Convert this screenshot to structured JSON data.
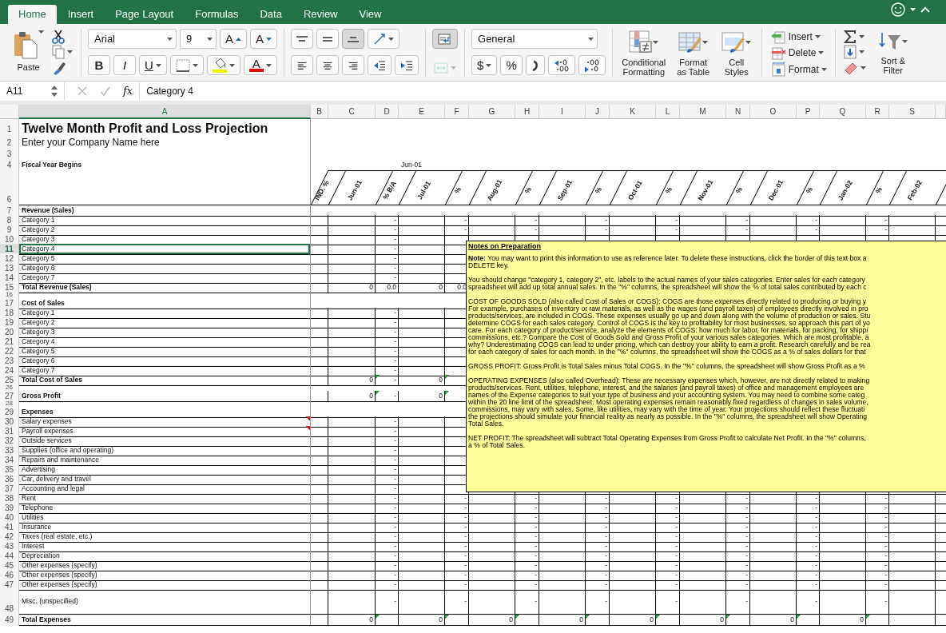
{
  "ribbon_tabs": [
    {
      "label": "Home",
      "selected": true
    },
    {
      "label": "Insert",
      "selected": false
    },
    {
      "label": "Page Layout",
      "selected": false
    },
    {
      "label": "Formulas",
      "selected": false
    },
    {
      "label": "Data",
      "selected": false
    },
    {
      "label": "Review",
      "selected": false
    },
    {
      "label": "View",
      "selected": false
    }
  ],
  "ribbon": {
    "clipboard": {
      "paste_label": "Paste"
    },
    "font": {
      "name": "Arial",
      "size": "9",
      "grow_glyph": "A",
      "shrink_glyph": "A",
      "bold_glyph": "B",
      "italic_glyph": "I",
      "underline_glyph": "U",
      "font_color_glyph": "A"
    },
    "alignment": {
      "vertical": [
        {
          "pressed": false
        },
        {
          "pressed": false
        },
        {
          "pressed": true
        }
      ],
      "wrap_text": {
        "pressed": true
      },
      "merge": {
        "disabled": true
      }
    },
    "number": {
      "format": "General",
      "currency_glyph": "$",
      "percent_glyph": "%"
    },
    "styles": [
      {
        "kind": "conditional",
        "label": "Conditional Formatting"
      },
      {
        "kind": "table",
        "label": "Format as Table"
      },
      {
        "kind": "cell_styles",
        "label": "Cell Styles"
      }
    ],
    "cells": [
      {
        "kind": "insert",
        "label": "Insert"
      },
      {
        "kind": "delete",
        "label": "Delete"
      },
      {
        "kind": "format",
        "label": "Format"
      }
    ],
    "editing": {
      "sort_label": "Sort & Filter"
    }
  },
  "formula_bar": {
    "name_box": "A11",
    "fx": "fx",
    "value": "Category 4"
  },
  "columns": [
    {
      "label": "A",
      "selected": true
    },
    {
      "label": "B",
      "selected": false
    },
    {
      "label": "C",
      "selected": false
    },
    {
      "label": "D",
      "selected": false
    },
    {
      "label": "E",
      "selected": false
    },
    {
      "label": "F",
      "selected": false
    },
    {
      "label": "G",
      "selected": false
    },
    {
      "label": "H",
      "selected": false
    },
    {
      "label": "I",
      "selected": false
    },
    {
      "label": "J",
      "selected": false
    },
    {
      "label": "K",
      "selected": false
    },
    {
      "label": "L",
      "selected": false
    },
    {
      "label": "M",
      "selected": false
    },
    {
      "label": "N",
      "selected": false
    },
    {
      "label": "O",
      "selected": false
    },
    {
      "label": "P",
      "selected": false
    },
    {
      "label": "Q",
      "selected": false
    },
    {
      "label": "R",
      "selected": false
    },
    {
      "label": "S",
      "selected": false
    }
  ],
  "rows": [
    {
      "number": "1",
      "kind": "title",
      "label": "Twelve Month Profit and Loss Projection",
      "selected": false
    },
    {
      "number": "2",
      "kind": "subtitle",
      "label": "Enter your Company Name here",
      "selected": false
    },
    {
      "number": "3",
      "kind": "blank",
      "selected": false
    },
    {
      "number": "4",
      "kind": "fiscal",
      "label": "Fiscal Year Begins",
      "cells": {
        "E": "Jun-01"
      },
      "selected": false
    },
    {
      "number": "6",
      "kind": "headers",
      "cells": {
        "B": "IND. %",
        "C": "Jun-01",
        "D": "% B/A",
        "E": "Jul-01",
        "F": "%",
        "G": "Aug-01",
        "H": "%",
        "I": "Sep-01",
        "J": "%",
        "K": "Oct-01",
        "L": "%",
        "M": "Nov-01",
        "N": "%",
        "O": "Dec-01",
        "P": "%",
        "Q": "Jan-02",
        "R": "%",
        "S": "Feb-02"
      },
      "selected": false
    },
    {
      "number": "7",
      "kind": "section",
      "label": "Revenue (Sales)",
      "selected": false
    },
    {
      "number": "8",
      "kind": "item",
      "label": "Category 1",
      "cells": {
        "D": "-",
        "F": "-",
        "H": "-",
        "J": "-",
        "L": "-",
        "N": "-",
        "P": "-",
        "R": "-"
      },
      "selected": false
    },
    {
      "number": "9",
      "kind": "item",
      "label": "Category 2",
      "cells": {
        "D": "-",
        "F": "-",
        "H": "-",
        "J": "-",
        "L": "-",
        "N": "-",
        "P": "-",
        "R": "-"
      },
      "selected": false
    },
    {
      "number": "10",
      "kind": "item",
      "label": "Category 3",
      "cells": {
        "D": "-"
      },
      "selected": false
    },
    {
      "number": "11",
      "kind": "item",
      "label": "Category 4",
      "cells": {
        "D": "-"
      },
      "selected": true
    },
    {
      "number": "12",
      "kind": "item",
      "label": "Category 5",
      "cells": {
        "D": "-"
      },
      "selected": false
    },
    {
      "number": "13",
      "kind": "item",
      "label": "Category 6",
      "cells": {
        "D": "-"
      },
      "selected": false
    },
    {
      "number": "14",
      "kind": "item",
      "label": "Category 7",
      "cells": {
        "D": "-"
      },
      "selected": false
    },
    {
      "number": "15",
      "kind": "total",
      "label": "Total Revenue (Sales)",
      "cells": {
        "C": "0",
        "D": "0.0",
        "E": "0",
        "F": "0.0"
      },
      "warning": false,
      "selected": false
    },
    {
      "number": "16",
      "kind": "spacer",
      "selected": false
    },
    {
      "number": "17",
      "kind": "section",
      "label": "Cost of Sales",
      "selected": false
    },
    {
      "number": "18",
      "kind": "item",
      "label": "Category 1",
      "cells": {
        "D": "-"
      },
      "selected": false
    },
    {
      "number": "19",
      "kind": "item",
      "label": "Category 2",
      "cells": {
        "D": "-"
      },
      "selected": false
    },
    {
      "number": "20",
      "kind": "item",
      "label": "Category 3",
      "cells": {
        "D": "-"
      },
      "selected": false
    },
    {
      "number": "21",
      "kind": "item",
      "label": "Category 4",
      "cells": {
        "D": "-"
      },
      "selected": false
    },
    {
      "number": "22",
      "kind": "item",
      "label": "Category 5",
      "cells": {
        "D": "-"
      },
      "selected": false
    },
    {
      "number": "23",
      "kind": "item",
      "label": "Category 6",
      "cells": {
        "D": "-"
      },
      "selected": false
    },
    {
      "number": "24",
      "kind": "item",
      "label": "Category 7",
      "cells": {
        "D": "-"
      },
      "selected": false
    },
    {
      "number": "25",
      "kind": "total",
      "label": "Total Cost of Sales",
      "cells": {
        "C": "0",
        "D": "-",
        "E": "0"
      },
      "warning": true,
      "selected": false
    },
    {
      "number": "26",
      "kind": "spacer",
      "selected": false
    },
    {
      "number": "27",
      "kind": "total",
      "label": "Gross Profit",
      "cells": {
        "C": "0",
        "D": "-",
        "E": "0"
      },
      "warning": true,
      "selected": false
    },
    {
      "number": "28",
      "kind": "spacer",
      "selected": false
    },
    {
      "number": "29",
      "kind": "section",
      "label": "Expenses",
      "selected": false
    },
    {
      "number": "30",
      "kind": "item",
      "label": "Salary expenses",
      "cells": {
        "D": "-"
      },
      "comment": true,
      "selected": false
    },
    {
      "number": "31",
      "kind": "item",
      "label": "Payroll expenses",
      "cells": {
        "D": "-"
      },
      "comment": true,
      "selected": false
    },
    {
      "number": "32",
      "kind": "item",
      "label": "Outside services",
      "cells": {
        "D": "-"
      },
      "selected": false
    },
    {
      "number": "33",
      "kind": "item",
      "label": "Supplies (office and operating)",
      "cells": {
        "D": "-"
      },
      "selected": false
    },
    {
      "number": "34",
      "kind": "item",
      "label": "Repairs and maintenance",
      "cells": {
        "D": "-"
      },
      "selected": false
    },
    {
      "number": "35",
      "kind": "item",
      "label": "Advertising",
      "cells": {
        "D": "-"
      },
      "selected": false
    },
    {
      "number": "36",
      "kind": "item",
      "label": "Car, delivery and travel",
      "cells": {
        "D": "-"
      },
      "selected": false
    },
    {
      "number": "37",
      "kind": "item",
      "label": "Accounting and legal",
      "cells": {
        "D": "-"
      },
      "selected": false
    },
    {
      "number": "38",
      "kind": "item",
      "label": "Rent",
      "cells": {
        "D": "-",
        "F": "-",
        "H": "-",
        "J": "-",
        "L": "-",
        "N": "-",
        "P": "-",
        "R": "-"
      },
      "selected": false
    },
    {
      "number": "39",
      "kind": "item",
      "label": "Telephone",
      "cells": {
        "D": "-",
        "F": "-",
        "H": "-",
        "J": "-",
        "L": "-",
        "N": "-",
        "P": "-",
        "R": "-"
      },
      "selected": false
    },
    {
      "number": "40",
      "kind": "item",
      "label": "Utilities",
      "cells": {
        "D": "-",
        "F": "-",
        "H": "-",
        "J": "-",
        "L": "-",
        "N": "-",
        "P": "-",
        "R": "-"
      },
      "selected": false
    },
    {
      "number": "41",
      "kind": "item",
      "label": "Insurance",
      "cells": {
        "D": "-",
        "F": "-",
        "H": "-",
        "J": "-",
        "L": "-",
        "N": "-",
        "P": "-",
        "R": "-"
      },
      "selected": false
    },
    {
      "number": "42",
      "kind": "item",
      "label": "Taxes (real estate, etc.)",
      "cells": {
        "D": "-",
        "F": "-",
        "H": "-",
        "J": "-",
        "L": "-",
        "N": "-",
        "P": "-",
        "R": "-"
      },
      "selected": false
    },
    {
      "number": "43",
      "kind": "item",
      "label": "Interest",
      "cells": {
        "D": "-",
        "F": "-",
        "H": "-",
        "J": "-",
        "L": "-",
        "N": "-",
        "P": "-",
        "R": "-"
      },
      "selected": false
    },
    {
      "number": "44",
      "kind": "item",
      "label": "Depreciation",
      "cells": {
        "D": "-",
        "F": "-",
        "H": "-",
        "J": "-",
        "L": "-",
        "N": "-",
        "P": "-",
        "R": "-"
      },
      "selected": false
    },
    {
      "number": "45",
      "kind": "item",
      "label": "Other expenses (specify)",
      "cells": {
        "D": "-",
        "F": "-",
        "H": "-",
        "J": "-",
        "L": "-",
        "N": "-",
        "P": "-",
        "R": "-"
      },
      "selected": false
    },
    {
      "number": "46",
      "kind": "item",
      "label": "Other expenses (specify)",
      "cells": {
        "D": "-",
        "F": "-",
        "H": "-",
        "J": "-",
        "L": "-",
        "N": "-",
        "P": "-",
        "R": "-"
      },
      "selected": false
    },
    {
      "number": "47",
      "kind": "item",
      "label": "Other expenses (specify)",
      "cells": {
        "D": "-",
        "F": "-",
        "H": "-",
        "J": "-",
        "L": "-",
        "N": "-",
        "P": "-",
        "R": "-"
      },
      "selected": false
    },
    {
      "number": "48",
      "kind": "tall_item",
      "label": "Misc. (unspecified)",
      "cells": {
        "D": "-",
        "F": "-",
        "H": "-",
        "J": "-",
        "L": "-",
        "N": "-",
        "P": "-",
        "R": "-"
      },
      "selected": false
    },
    {
      "number": "49",
      "kind": "total",
      "label": "Total Expenses",
      "cells": {
        "C": "0",
        "E": "0",
        "G": "0",
        "I": "0",
        "K": "0",
        "M": "0",
        "O": "0",
        "Q": "0"
      },
      "warning": true,
      "selected": false
    }
  ],
  "note": {
    "title": "Notes on Preparation",
    "paragraphs": [
      [
        "**Note:** You may want to print this information to use as reference later. To delete these instructions, click the border of this text box a",
        "DELETE key."
      ],
      [
        "You should change \"category 1, category 2\", etc. labels to the actual names of your sales categories. Enter sales for each category",
        "spreadsheet will add up total annual sales. In the \"%\" columns, the spreadsheet will show the % of total sales contributed by each c"
      ],
      [
        "COST OF GOODS SOLD (also called Cost of Sales or COGS): COGS are those expenses directly related to producing or buying y",
        "For example, purchases of inventory or raw materials, as well as the wages (and payroll taxes) of employees directly involved in pro",
        "products/services, are included in COGS. These expenses usually go up and down along with the volume of production or sales. Stu",
        "determine COGS for each sales category. Control of COGS is the key to profitability for most businesses, so approach this part of yo",
        "care. For each category of product/service, analyze the elements of COGS: how much for labor, for materials, for packing, for shippi",
        "commissions, etc.? Compare the Cost of Goods Sold and Gross Profit of your various sales categories. Which are most profitable, a",
        "why? Underestimating COGS can lead to under pricing, which can destroy your ability to earn a profit. Research carefully and be rea",
        "for each category of sales for each month. In the \"%\" columns, the spreadsheet will show the COGS as a % of sales dollars for that"
      ],
      [
        "GROSS PROFIT: Gross Profit is Total Sales minus Total COGS. In the \"%\" columns, the spreadsheet will show Gross Profit as a %"
      ],
      [
        "OPERATING EXPENSES (also called Overhead): These are necessary expenses which, however, are not directly related to making",
        "products/services. Rent, utilities, telephone, interest, and the salaries (and payroll taxes) of office and management employees are",
        "names of the Expense categories to suit your type of business and your accounting system.  You may need to combine some categ",
        "within the 20 line limit of the spreadsheet. Most operating expenses remain reasonably fixed regardless of changes in sales volume,",
        "commissions, may vary with sales. Some, like utilities, may vary with the time of year. Your projections should reflect these fluctuati",
        "the projections should simulate your financial reality as nearly as possible. In the \"%\" columns, the spreadsheet will show Operating",
        "Total Sales."
      ],
      [
        "NET PROFIT: The spreadsheet will subtract Total Operating Expenses from Gross Profit to calculate Net Profit. In the \"%\" columns,",
        "a % of Total Sales."
      ]
    ]
  }
}
